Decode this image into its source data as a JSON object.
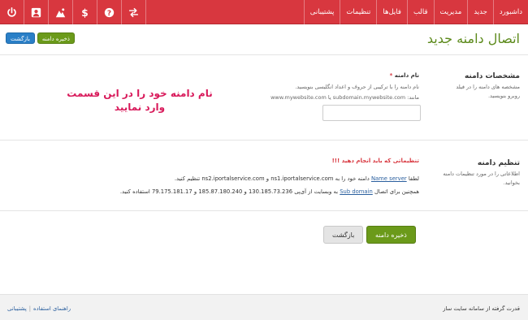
{
  "nav": {
    "items": [
      "داشبورد",
      "جدید",
      "مدیریت",
      "قالب",
      "فایل‌ها",
      "تنظیمات",
      "پشتیبانی"
    ]
  },
  "toolbar_icons": [
    "power-icon",
    "user-icon",
    "image-icon",
    "dollar-icon",
    "help-icon",
    "swap-icon"
  ],
  "header": {
    "title": "اتصال دامنه جدید",
    "save_label": "ذخیره دامنه",
    "back_label": "بازگشت"
  },
  "domain_section": {
    "title": "مشخصات دامنه",
    "desc": "مشخصه های دامنه را در فیلد روبرو بنویسید.",
    "field_label": "نام دامنه",
    "required_mark": "*",
    "help1": "نام دامنه را با ترکیبی از حروف و اعداد انگلیسی بنویسید.",
    "help2": "مانند: subdomain.mywebsite.com یا www.mywebsite.com",
    "input_value": "",
    "callout": "نام دامنه خود را در این قسمت وارد نمایید"
  },
  "settings_section": {
    "title": "تنظیم دامنه",
    "desc": "اطلاعاتی را در مورد تنظیمات دامنه بخوانید.",
    "warning": "تنظیماتی که باید انجام دهید !!!",
    "line1_a": "لطفا",
    "line1_link": "Name server",
    "line1_b": "دامنه خود را به ns1.iportalservice.com و ns2.iportalservice.com تنظیم کنید.",
    "line2_a": "همچنین برای اتصال",
    "line2_link": "Sub domain",
    "line2_b": "به وبسایت از آی‌پی 130.185.73.236 و 185.87.180.240 و 79.175.181.17 استفاده کنید."
  },
  "actions": {
    "save_label": "ذخیره دامنه",
    "back_label": "بازگشت"
  },
  "footer": {
    "powered": "قدرت گرفته از سامانه سایت ساز",
    "help_link": "راهنمای استفاده",
    "separator": "|",
    "support_link": "پشتیبانی"
  },
  "colors": {
    "topbar": "#d8373f",
    "title": "#5c8a1b",
    "save": "#6b9a1a",
    "back_small": "#2a7fc7",
    "callout": "#d8195a"
  }
}
